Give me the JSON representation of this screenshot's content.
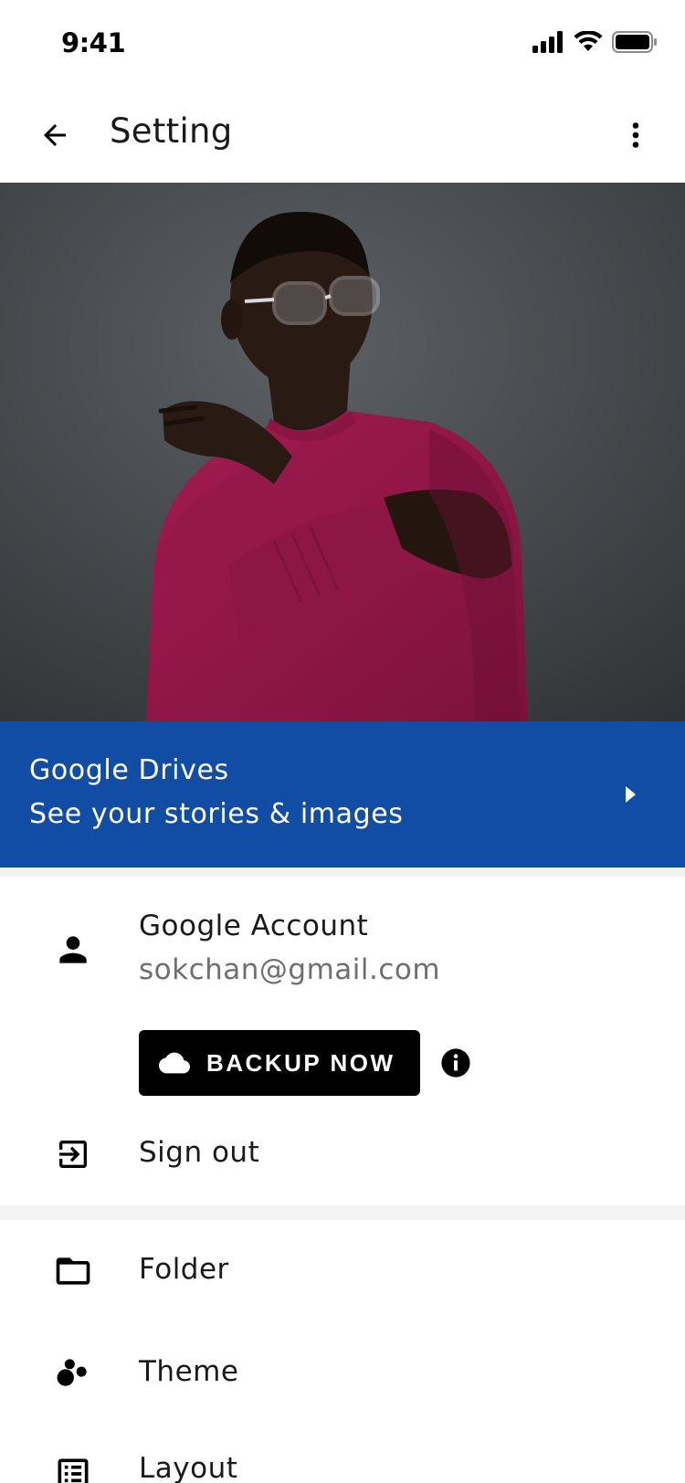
{
  "status_bar": {
    "time": "9:41",
    "icons": [
      "signal-icon",
      "wifi-icon",
      "battery-icon"
    ]
  },
  "app_bar": {
    "title": "Setting",
    "back_icon": "arrow-back-icon",
    "more_icon": "more-vertical-icon"
  },
  "hero": {
    "image": "portrait-photo",
    "colors": {
      "background": "#3d4043",
      "sweater": "#8f1747"
    }
  },
  "drive_banner": {
    "title": "Google Drives",
    "subtitle": "See your stories & images",
    "icon": "chevron-right-icon",
    "color": "#114da4"
  },
  "account": {
    "icon": "person-icon",
    "title": "Google Account",
    "email": "sokchan@gmail.com",
    "backup_button": {
      "label": "BACKUP NOW",
      "icon": "cloud-icon"
    },
    "info_icon": "info-icon",
    "sign_out": {
      "label": "Sign out",
      "icon": "exit-icon"
    }
  },
  "menu": {
    "items": [
      {
        "label": "Folder",
        "icon": "folder-icon"
      },
      {
        "label": "Theme",
        "icon": "theme-icon"
      },
      {
        "label": "Layout",
        "icon": "layout-icon"
      }
    ]
  }
}
